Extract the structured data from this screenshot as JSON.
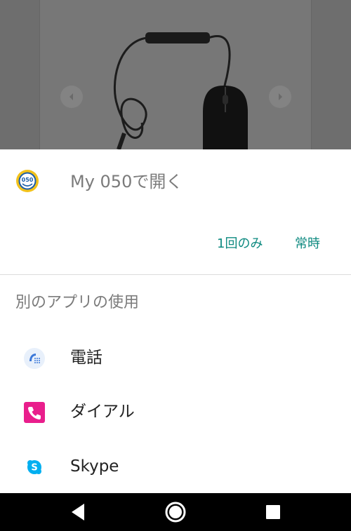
{
  "background": {
    "description_icons": [
      "chevron-left-icon",
      "chevron-right-icon"
    ]
  },
  "chooser": {
    "open_with": "My 050で開く",
    "once_label": "1回のみ",
    "always_label": "常時",
    "other_apps_title": "別のアプリの使用",
    "apps": [
      {
        "label": "電話",
        "icon": "phone-dialer-icon"
      },
      {
        "label": "ダイアル",
        "icon": "dial-app-icon"
      },
      {
        "label": "Skype",
        "icon": "skype-icon"
      }
    ]
  },
  "colors": {
    "accent": "#0e8a80",
    "dial_pink": "#e91e8c",
    "skype_blue": "#00aff0",
    "logo_yellow": "#f2c21b",
    "logo_blue": "#1d5fa8"
  },
  "navbar": {
    "buttons": [
      "back-icon",
      "home-icon",
      "recent-apps-icon"
    ]
  }
}
